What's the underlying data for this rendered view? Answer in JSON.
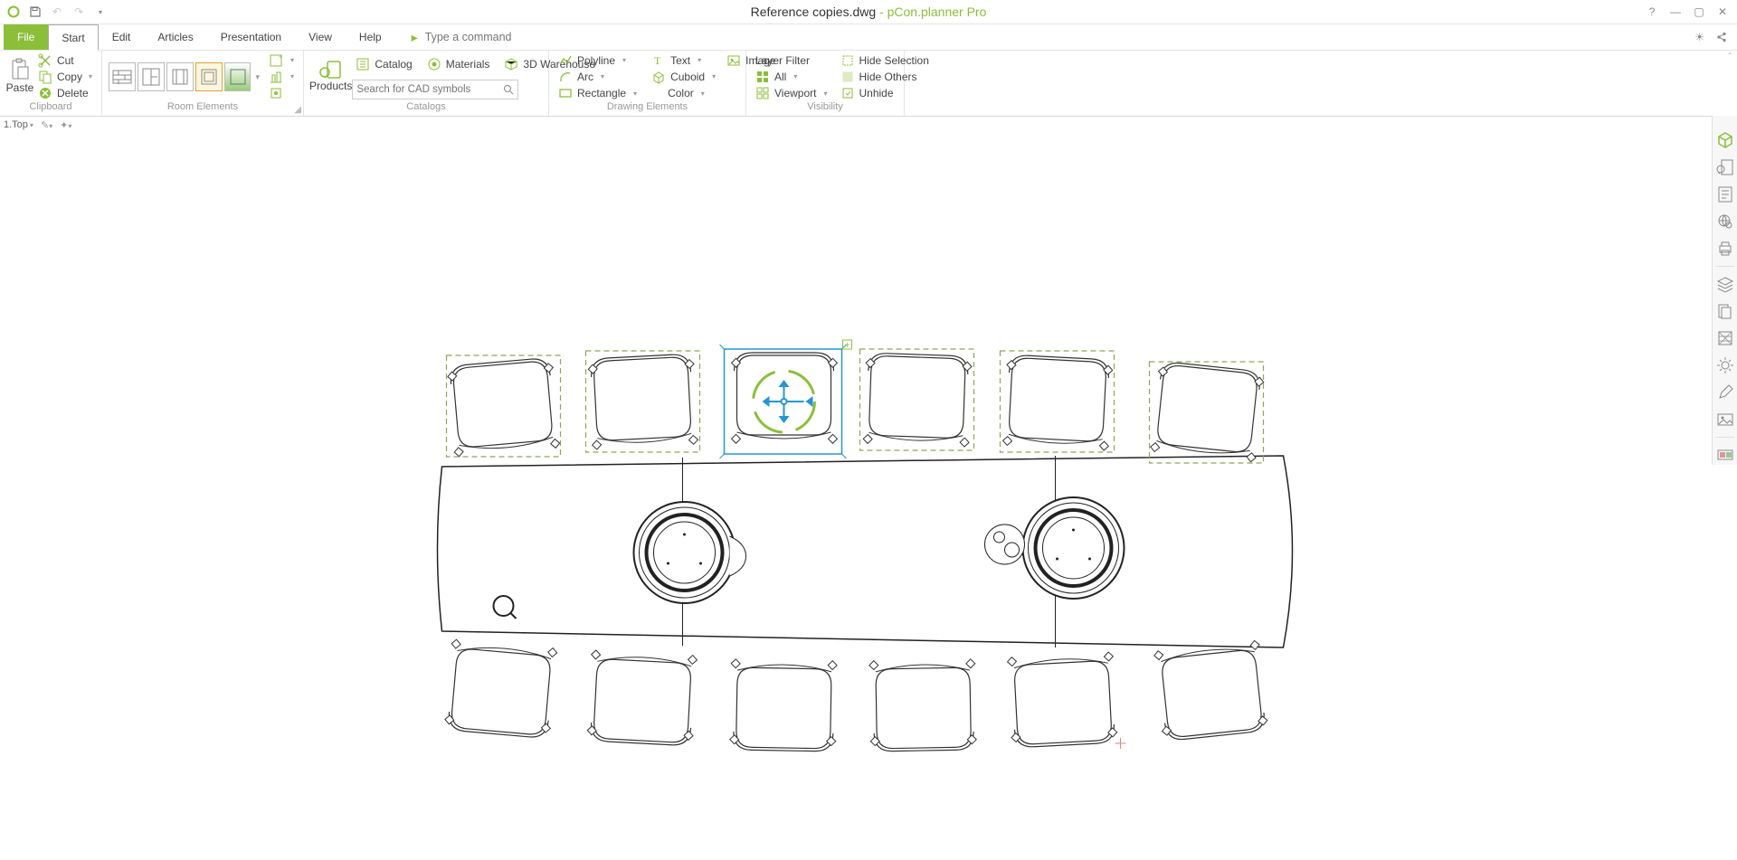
{
  "title": {
    "doc": "Reference copies.dwg",
    "app": " - pCon.planner Pro"
  },
  "tabs": {
    "file": "File",
    "start": "Start",
    "edit": "Edit",
    "articles": "Articles",
    "presentation": "Presentation",
    "view": "View",
    "help": "Help"
  },
  "cmd_placeholder": "Type a command",
  "ribbon": {
    "clipboard": {
      "label": "Clipboard",
      "paste": "Paste",
      "cut": "Cut",
      "copy": "Copy",
      "delete": "Delete"
    },
    "room": {
      "label": "Room Elements"
    },
    "catalogs": {
      "label": "Catalogs",
      "products": "Products",
      "catalog": "Catalog",
      "materials": "Materials",
      "warehouse": "3D Warehouse",
      "search_placeholder": "Search for CAD symbols"
    },
    "drawing": {
      "label": "Drawing Elements",
      "polyline": "Polyline",
      "arc": "Arc",
      "rectangle": "Rectangle",
      "text": "Text",
      "cuboid": "Cuboid",
      "image": "Image",
      "color": "Color"
    },
    "visibility": {
      "label": "Visibility",
      "layerfilter": "Layer Filter",
      "all": "All",
      "viewport": "Viewport",
      "hidesel": "Hide Selection",
      "hideothers": "Hide Others",
      "unhide": "Unhide"
    }
  },
  "viewport": {
    "header": "1.Top"
  }
}
